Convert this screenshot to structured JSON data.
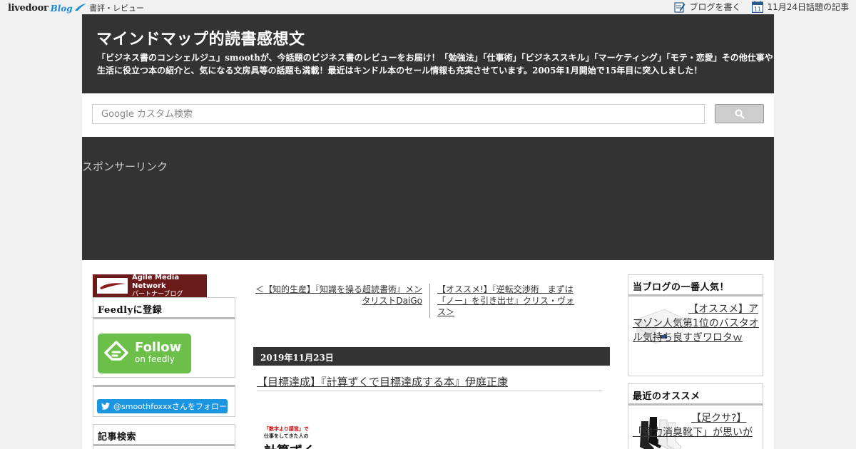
{
  "topbar": {
    "logo_main": "livedoor",
    "logo_blog": "Blog",
    "category": "書評・レビュー",
    "write_label": "ブログを書く",
    "calendar_day": "11",
    "today_label": "11月24日話題の記事"
  },
  "header": {
    "title": "マインドマップ的読書感想文",
    "description": "「ビジネス書のコンシェルジュ」smoothが、今話題のビジネス書のレビューをお届け！「勉強法」「仕事術」「ビジネススキル」「マーケティング」「モテ・恋愛」その他仕事や生活に役立つ本の紹介と、気になる文房具等の話題も満載！最近はキンドル本のセール情報も充実させています。2005年1月開始で15年目に突入しました！"
  },
  "search": {
    "placeholder": "Google カスタム検索"
  },
  "sponsor": {
    "label": "スポンサーリンク"
  },
  "sidebar_left": {
    "amn_title": "Agile Media Network",
    "amn_subtitle": "パートナーブログ",
    "feedly_heading": "Feedlyに登録",
    "feedly_follow": "Follow",
    "feedly_on": "on feedly",
    "twitter_follow": "@smoothfoxxxさんをフォロー",
    "search_heading": "記事検索"
  },
  "post": {
    "prev_link": "＜【知的生産】『知識を操る超読書術』メンタリストDaiGo",
    "next_link": "【オススメ!】『逆転交渉術　まずは「ノー」を引き出せ』クリス・ヴォス＞",
    "date": "2019年11月23日",
    "title": "【目標達成】『計算ずくで目標達成する本』伊庭正康",
    "cover_line1": "「数字より感覚」で",
    "cover_line2": "仕事をしてきた人の",
    "cover_line3": "計算ずく"
  },
  "sidebar_right": {
    "popular_heading": "当ブログの一番人気！",
    "popular_item": "【オススメ】アマゾン人気第1位のバスタオル気持ち良すぎワロタｗ",
    "recent_heading": "最近のオススメ",
    "recent_item": "【足クサ?】「強力消臭靴下」が思いが"
  },
  "colors": {
    "header_bg": "#333333",
    "feedly_green": "#6cc04a",
    "twitter_blue": "#1b95e0",
    "amn_red": "#6b1a1a"
  }
}
